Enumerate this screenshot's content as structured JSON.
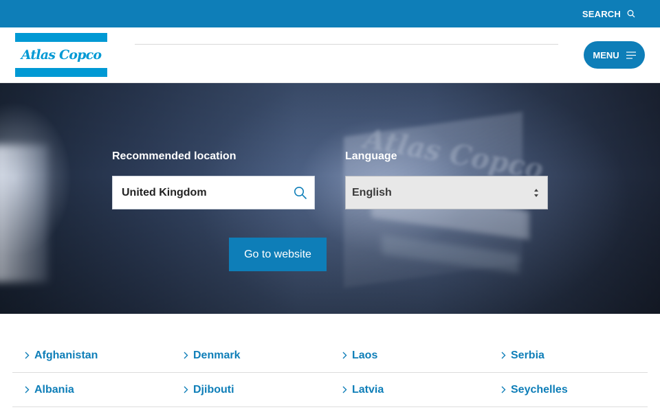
{
  "topbar": {
    "search_label": "SEARCH",
    "search_icon": "search-icon",
    "color": "#0e7eb8"
  },
  "header": {
    "brand": "Atlas Copco",
    "brand_color": "#0099d4",
    "menu_label": "MENU",
    "menu_icon": "hamburger-icon"
  },
  "hero": {
    "location_label": "Recommended location",
    "location_value": "United Kingdom",
    "language_label": "Language",
    "language_value": "English",
    "cta_label": "Go to website"
  },
  "countries": {
    "columns": [
      [
        "Afghanistan",
        "Albania"
      ],
      [
        "Denmark",
        "Djibouti"
      ],
      [
        "Laos",
        "Latvia"
      ],
      [
        "Serbia",
        "Seychelles"
      ]
    ]
  }
}
